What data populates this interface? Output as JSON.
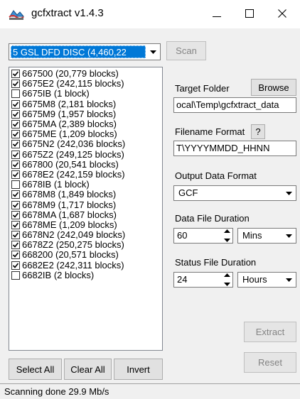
{
  "window": {
    "title": "gcfxtract  v1.4.3",
    "minimize_glyph": "—",
    "maximize_glyph": "☐",
    "close_glyph": "✕"
  },
  "volume": {
    "selected": "5 GSL DFD DISC  (4,460,22"
  },
  "scan_button": {
    "label": "Scan",
    "enabled": false
  },
  "streams": [
    {
      "label": "667500 (20,779 blocks)",
      "checked": true
    },
    {
      "label": "6675E2 (242,115 blocks)",
      "checked": true
    },
    {
      "label": "6675IB (1 block)",
      "checked": false
    },
    {
      "label": "6675M8 (2,181 blocks)",
      "checked": true
    },
    {
      "label": "6675M9 (1,957 blocks)",
      "checked": true
    },
    {
      "label": "6675MA (2,389 blocks)",
      "checked": true
    },
    {
      "label": "6675ME (1,209 blocks)",
      "checked": true
    },
    {
      "label": "6675N2 (242,036 blocks)",
      "checked": true
    },
    {
      "label": "6675Z2 (249,125 blocks)",
      "checked": true
    },
    {
      "label": "667800 (20,541 blocks)",
      "checked": true
    },
    {
      "label": "6678E2 (242,159 blocks)",
      "checked": true
    },
    {
      "label": "6678IB (1 block)",
      "checked": false
    },
    {
      "label": "6678M8 (1,849 blocks)",
      "checked": true
    },
    {
      "label": "6678M9 (1,717 blocks)",
      "checked": true
    },
    {
      "label": "6678MA (1,687 blocks)",
      "checked": true
    },
    {
      "label": "6678ME (1,209 blocks)",
      "checked": true
    },
    {
      "label": "6678N2 (242,049 blocks)",
      "checked": true
    },
    {
      "label": "6678Z2 (250,275 blocks)",
      "checked": true
    },
    {
      "label": "668200 (20,571 blocks)",
      "checked": true
    },
    {
      "label": "6682E2 (242,311 blocks)",
      "checked": true
    },
    {
      "label": "6682IB (2 blocks)",
      "checked": false
    }
  ],
  "list_buttons": {
    "select_all": "Select All",
    "clear_all": "Clear All",
    "invert": "Invert"
  },
  "target_folder": {
    "label": "Target Folder",
    "browse": "Browse",
    "value": "ocal\\Temp\\gcfxtract_data"
  },
  "filename_format": {
    "label": "Filename Format",
    "help": "?",
    "value": "T\\YYYYMMDD_HHNN"
  },
  "output_format": {
    "label": "Output Data Format",
    "selected": "GCF"
  },
  "data_duration": {
    "label": "Data File Duration",
    "value": "60",
    "unit": "Mins"
  },
  "status_duration": {
    "label": "Status File Duration",
    "value": "24",
    "unit": "Hours"
  },
  "actions": {
    "extract": "Extract",
    "reset": "Reset"
  },
  "status": {
    "text": "Scanning done 29.9 Mb/s"
  }
}
